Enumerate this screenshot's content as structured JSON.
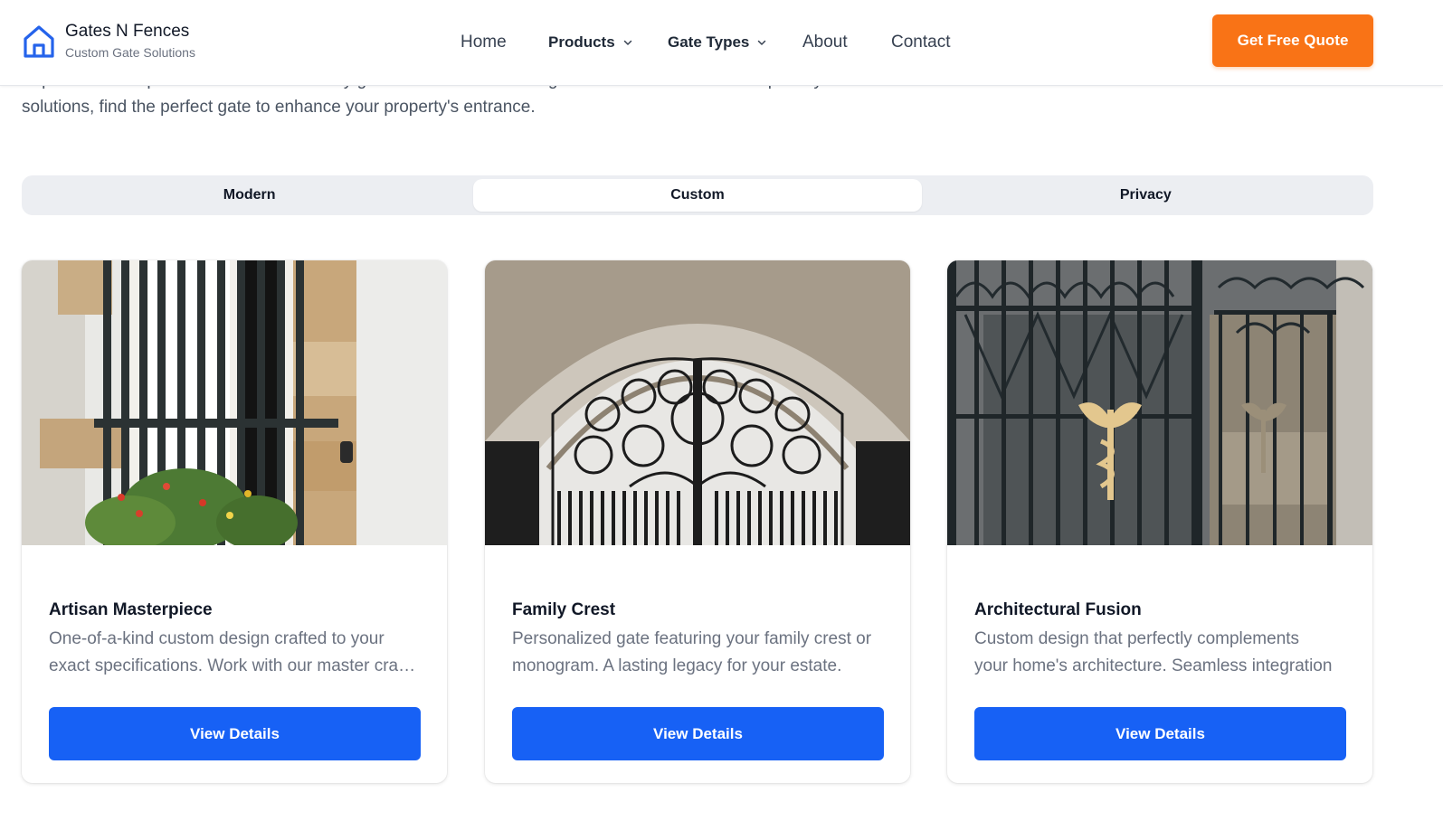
{
  "header": {
    "brand_name": "Gates N Fences",
    "brand_tagline": "Custom Gate Solutions",
    "nav": {
      "home": "Home",
      "products": "Products",
      "gate_types": "Gate Types",
      "about": "About",
      "contact": "Contact"
    },
    "cta_label": "Get Free Quote"
  },
  "intro": {
    "line1": "Explore our complete collection of driveway gates. From modern designs to custom creations and privacy",
    "line2": "solutions, find the perfect gate to enhance your property's entrance."
  },
  "tabs": [
    {
      "label": "Modern",
      "active": false
    },
    {
      "label": "Custom",
      "active": true
    },
    {
      "label": "Privacy",
      "active": false
    }
  ],
  "cards": [
    {
      "title": "Artisan Masterpiece",
      "desc_line1": "One-of-a-kind custom design crafted to your",
      "desc_line2": "exact specifications. Work with our master craftsmen",
      "button": "View Details"
    },
    {
      "title": "Family Crest",
      "desc_line1": "Personalized gate featuring your family crest or",
      "desc_line2": "monogram. A lasting legacy for your estate.",
      "button": "View Details"
    },
    {
      "title": "Architectural Fusion",
      "desc_line1": "Custom design that perfectly complements",
      "desc_line2": "your home's architecture. Seamless integration",
      "button": "View Details"
    }
  ],
  "colors": {
    "brand_blue": "#1761f5",
    "cta_orange": "#f97316",
    "logo_blue": "#2563eb"
  }
}
